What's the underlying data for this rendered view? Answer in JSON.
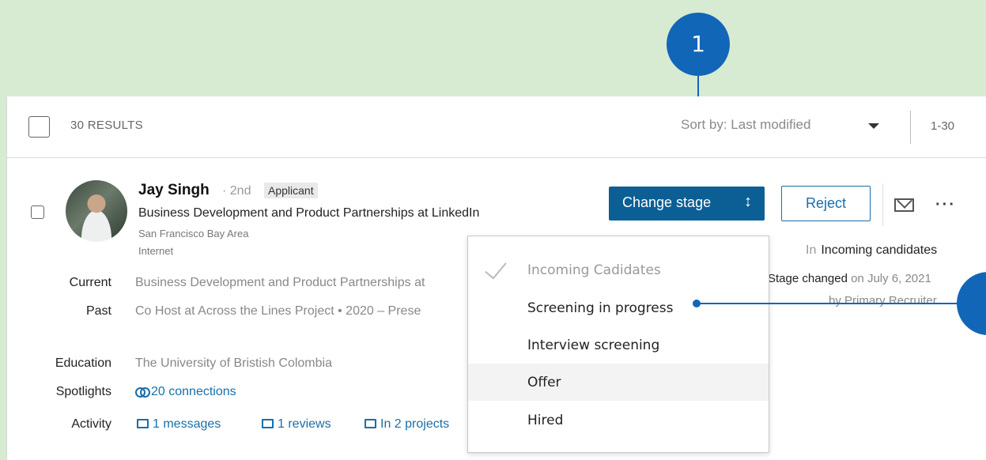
{
  "results": {
    "count_label": "30 RESULTS",
    "sort_label": "Sort by: Last modified",
    "range": "1-30"
  },
  "candidate": {
    "name": "Jay Singh",
    "degree": "· 2nd",
    "tag": "Applicant",
    "headline": "Business Development and Product Partnerships at LinkedIn",
    "location": "San Francisco Bay Area",
    "industry": "Internet",
    "current_label": "Current",
    "current_value": "Business Development and Product Partnerships at",
    "past_label": "Past",
    "past_value": "Co Host at Across the Lines Project  •  2020 – Prese",
    "education_label": "Education",
    "education_value": "The University of Bristish Colombia",
    "spotlights_label": "Spotlights",
    "spotlights_value": "20 connections",
    "activity_label": "Activity",
    "activity_messages": "1 messages",
    "activity_reviews": "1 reviews",
    "activity_projects": "In 2 projects"
  },
  "actions": {
    "change_stage": "Change stage",
    "change_stage_icon": "↕",
    "reject": "Reject",
    "more": "···"
  },
  "stage": {
    "in_label": "In",
    "in_value": "Incoming candidates",
    "changed_label": "Stage changed",
    "changed_date": " on July 6, 2021",
    "changed_by": "by Primary Recruiter"
  },
  "dropdown": {
    "items": [
      {
        "label": "Incoming Cadidates"
      },
      {
        "label": "Screening in progress"
      },
      {
        "label": "Interview screening"
      },
      {
        "label": "Offer"
      },
      {
        "label": "Hired"
      }
    ]
  },
  "callouts": {
    "first": "1"
  },
  "colors": {
    "accent": "#0b5f94",
    "callout": "#1266b8",
    "background": "#d7ebd2"
  }
}
